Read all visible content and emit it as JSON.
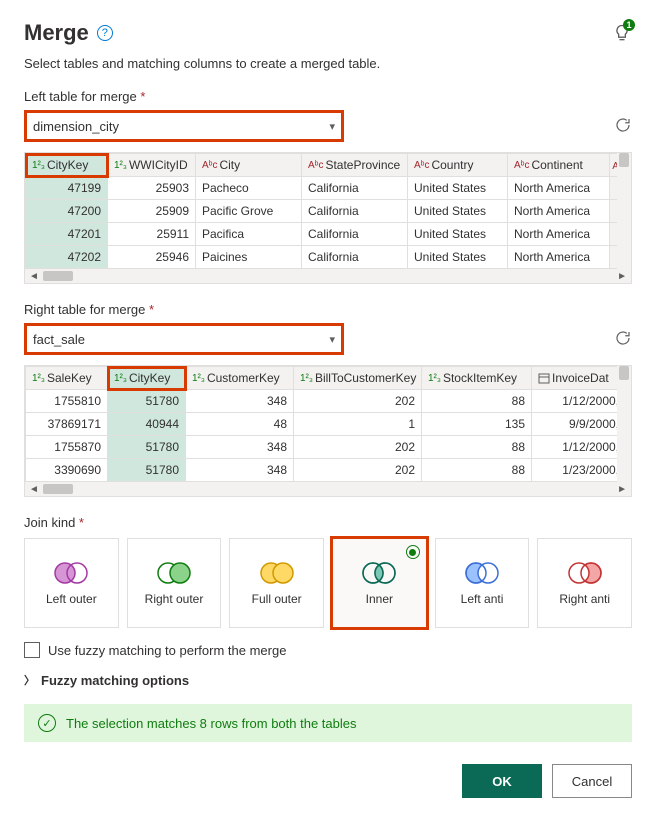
{
  "header": {
    "title": "Merge",
    "tip_count": "1",
    "subtitle": "Select tables and matching columns to create a merged table."
  },
  "left": {
    "label": "Left table for merge",
    "selected": "dimension_city",
    "cols": {
      "c0": "CityKey",
      "c1": "WWICityID",
      "c2": "City",
      "c3": "StateProvince",
      "c4": "Country",
      "c5": "Continent"
    },
    "rows": [
      {
        "c0": "47199",
        "c1": "25903",
        "c2": "Pacheco",
        "c3": "California",
        "c4": "United States",
        "c5": "North America"
      },
      {
        "c0": "47200",
        "c1": "25909",
        "c2": "Pacific Grove",
        "c3": "California",
        "c4": "United States",
        "c5": "North America"
      },
      {
        "c0": "47201",
        "c1": "25911",
        "c2": "Pacifica",
        "c3": "California",
        "c4": "United States",
        "c5": "North America"
      },
      {
        "c0": "47202",
        "c1": "25946",
        "c2": "Paicines",
        "c3": "California",
        "c4": "United States",
        "c5": "North America"
      }
    ]
  },
  "right": {
    "label": "Right table for merge",
    "selected": "fact_sale",
    "cols": {
      "c0": "SaleKey",
      "c1": "CityKey",
      "c2": "CustomerKey",
      "c3": "BillToCustomerKey",
      "c4": "StockItemKey",
      "c5": "InvoiceDat"
    },
    "rows": [
      {
        "c0": "1755810",
        "c1": "51780",
        "c2": "348",
        "c3": "202",
        "c4": "88",
        "c5": "1/12/2000,"
      },
      {
        "c0": "37869171",
        "c1": "40944",
        "c2": "48",
        "c3": "1",
        "c4": "135",
        "c5": "9/9/2000,"
      },
      {
        "c0": "1755870",
        "c1": "51780",
        "c2": "348",
        "c3": "202",
        "c4": "88",
        "c5": "1/12/2000,"
      },
      {
        "c0": "3390690",
        "c1": "51780",
        "c2": "348",
        "c3": "202",
        "c4": "88",
        "c5": "1/23/2000,"
      }
    ]
  },
  "join": {
    "label": "Join kind",
    "options": {
      "left_outer": "Left outer",
      "right_outer": "Right outer",
      "full_outer": "Full outer",
      "inner": "Inner",
      "left_anti": "Left anti",
      "right_anti": "Right anti"
    }
  },
  "fuzzy": {
    "checkbox_label": "Use fuzzy matching to perform the merge",
    "expander_label": "Fuzzy matching options"
  },
  "status": {
    "message": "The selection matches 8 rows from both the tables"
  },
  "footer": {
    "ok": "OK",
    "cancel": "Cancel"
  }
}
